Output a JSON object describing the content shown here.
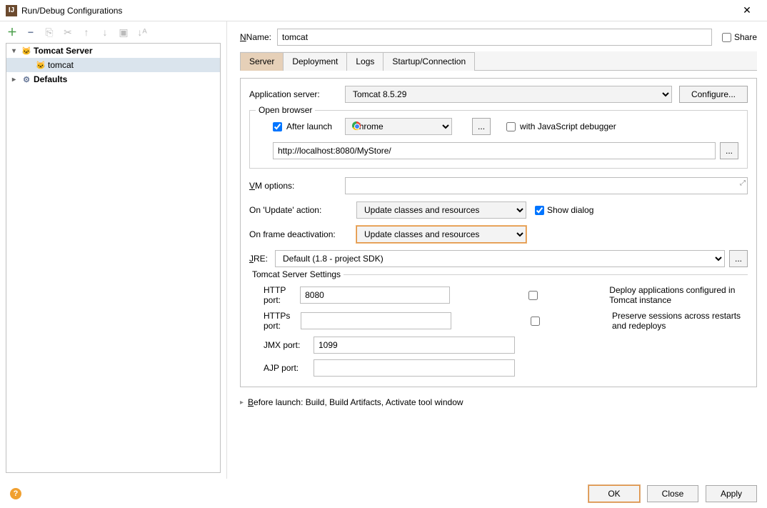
{
  "window": {
    "title": "Run/Debug Configurations"
  },
  "tree": {
    "tomcat_server": "Tomcat Server",
    "tomcat_child": "tomcat",
    "defaults": "Defaults"
  },
  "header": {
    "name_label": "Name:",
    "name_value": "tomcat",
    "share_label": "Share"
  },
  "tabs": {
    "server": "Server",
    "deployment": "Deployment",
    "logs": "Logs",
    "startup": "Startup/Connection"
  },
  "server": {
    "appserver_label": "Application server:",
    "appserver_value": "Tomcat 8.5.29",
    "configure": "Configure...",
    "open_browser": "Open browser",
    "after_launch": "After launch",
    "browser": "Chrome",
    "with_js": "with JavaScript debugger",
    "url": "http://localhost:8080/MyStore/",
    "vm_label": "VM options:",
    "on_update_label": "On 'Update' action:",
    "on_update_value": "Update classes and resources",
    "show_dialog": "Show dialog",
    "on_frame_label": "On frame deactivation:",
    "on_frame_value": "Update classes and resources",
    "jre_label": "JRE:",
    "jre_value": "Default",
    "jre_hint": "(1.8 - project SDK)",
    "tss_legend": "Tomcat Server Settings",
    "http_port_label": "HTTP port:",
    "http_port": "8080",
    "https_port_label": "HTTPs port:",
    "https_port": "",
    "jmx_port_label": "JMX port:",
    "jmx_port": "1099",
    "ajp_port_label": "AJP port:",
    "ajp_port": "",
    "deploy_apps": "Deploy applications configured in Tomcat instance",
    "preserve_sessions": "Preserve sessions across restarts and redeploys"
  },
  "before_launch": "Before launch: Build, Build Artifacts, Activate tool window",
  "footer": {
    "ok": "OK",
    "close": "Close",
    "apply": "Apply"
  },
  "ellipsis": "..."
}
